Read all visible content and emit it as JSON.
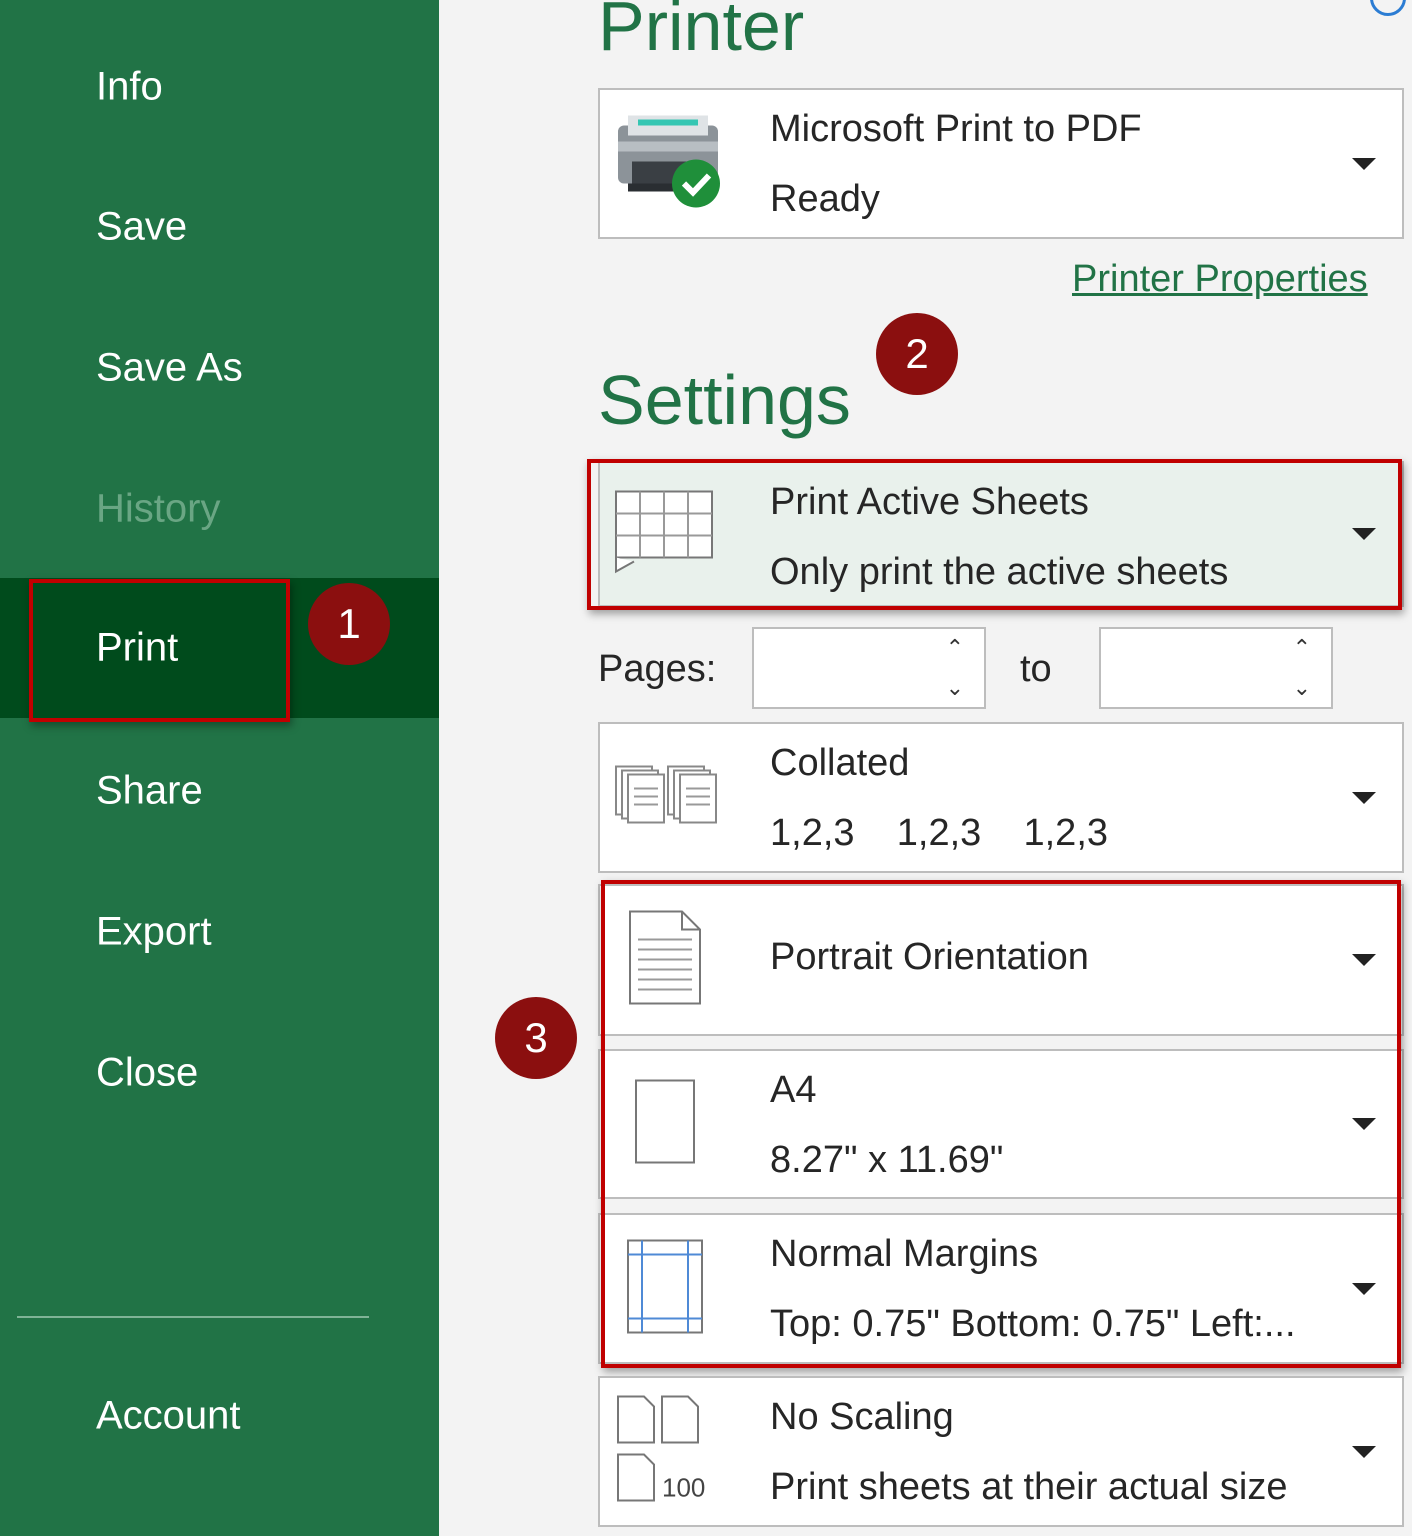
{
  "sidebar": {
    "items": [
      {
        "label": "Info"
      },
      {
        "label": "Save"
      },
      {
        "label": "Save As"
      },
      {
        "label": "History"
      },
      {
        "label": "Print"
      },
      {
        "label": "Share"
      },
      {
        "label": "Export"
      },
      {
        "label": "Close"
      },
      {
        "label": "Account"
      }
    ]
  },
  "printer": {
    "heading": "Printer",
    "name": "Microsoft Print to PDF",
    "status": "Ready",
    "properties_link": "Printer Properties"
  },
  "settings": {
    "heading": "Settings",
    "what_to_print": {
      "title": "Print Active Sheets",
      "subtitle": "Only print the active sheets"
    },
    "pages_label": "Pages:",
    "to_label": "to",
    "collation": {
      "title": "Collated",
      "subtitle": "1,2,3    1,2,3    1,2,3"
    },
    "orientation": {
      "title": "Portrait Orientation"
    },
    "paper": {
      "title": "A4",
      "subtitle": "8.27\" x 11.69\""
    },
    "margins": {
      "title": "Normal Margins",
      "subtitle": "Top: 0.75\" Bottom: 0.75\" Left:..."
    },
    "scaling": {
      "title": "No Scaling",
      "subtitle": "Print sheets at their actual size",
      "icon_text": "100"
    }
  },
  "annotations": {
    "step1": "1",
    "step2": "2",
    "step3": "3"
  },
  "colors": {
    "accent": "#217346",
    "active": "#004b1c",
    "callout": "#c00000",
    "badge": "#8b0f0f"
  }
}
